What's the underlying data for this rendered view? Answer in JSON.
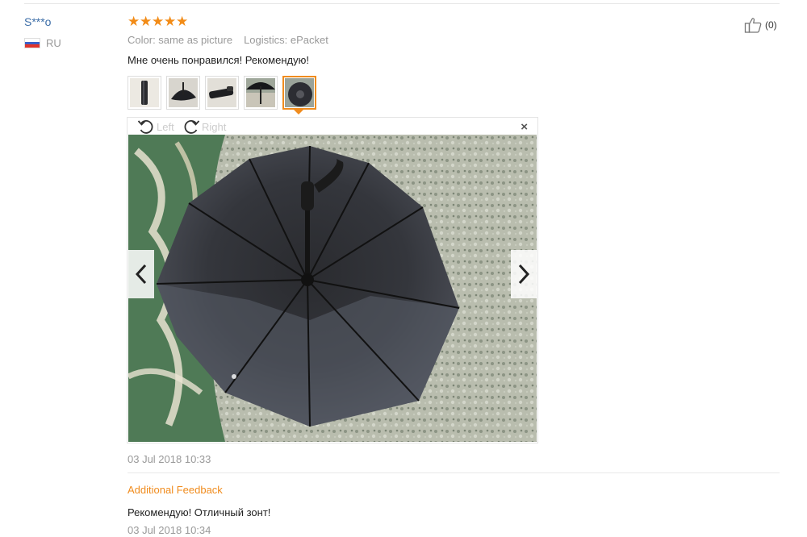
{
  "review": {
    "user_name": "S***o",
    "country_code": "RU",
    "rating_stars": 5,
    "color_label": "Color: same as picture",
    "logistics_label": "Logistics: ePacket",
    "text": "Мне очень понравился! Рекомендую!",
    "useful_count": "(0)",
    "date": "03 Jul 2018 10:33"
  },
  "gallery": {
    "thumbnails": [
      {
        "icon": "closed-umbrella-photo"
      },
      {
        "icon": "umbrella-side-photo"
      },
      {
        "icon": "folded-umbrella-photo"
      },
      {
        "icon": "open-umbrella-photo"
      },
      {
        "icon": "umbrella-top-photo",
        "active": true
      }
    ],
    "rotate_left_label": "Left",
    "rotate_right_label": "Right",
    "close_label": "×"
  },
  "additional_feedback": {
    "heading": "Additional Feedback",
    "text": "Рекомендую! Отличный зонт!",
    "date": "03 Jul 2018 10:34"
  },
  "colors": {
    "accent_orange": "#f08c1e",
    "star": "#f28c18",
    "username_blue": "#3d6ea8",
    "muted_text": "#999999"
  }
}
